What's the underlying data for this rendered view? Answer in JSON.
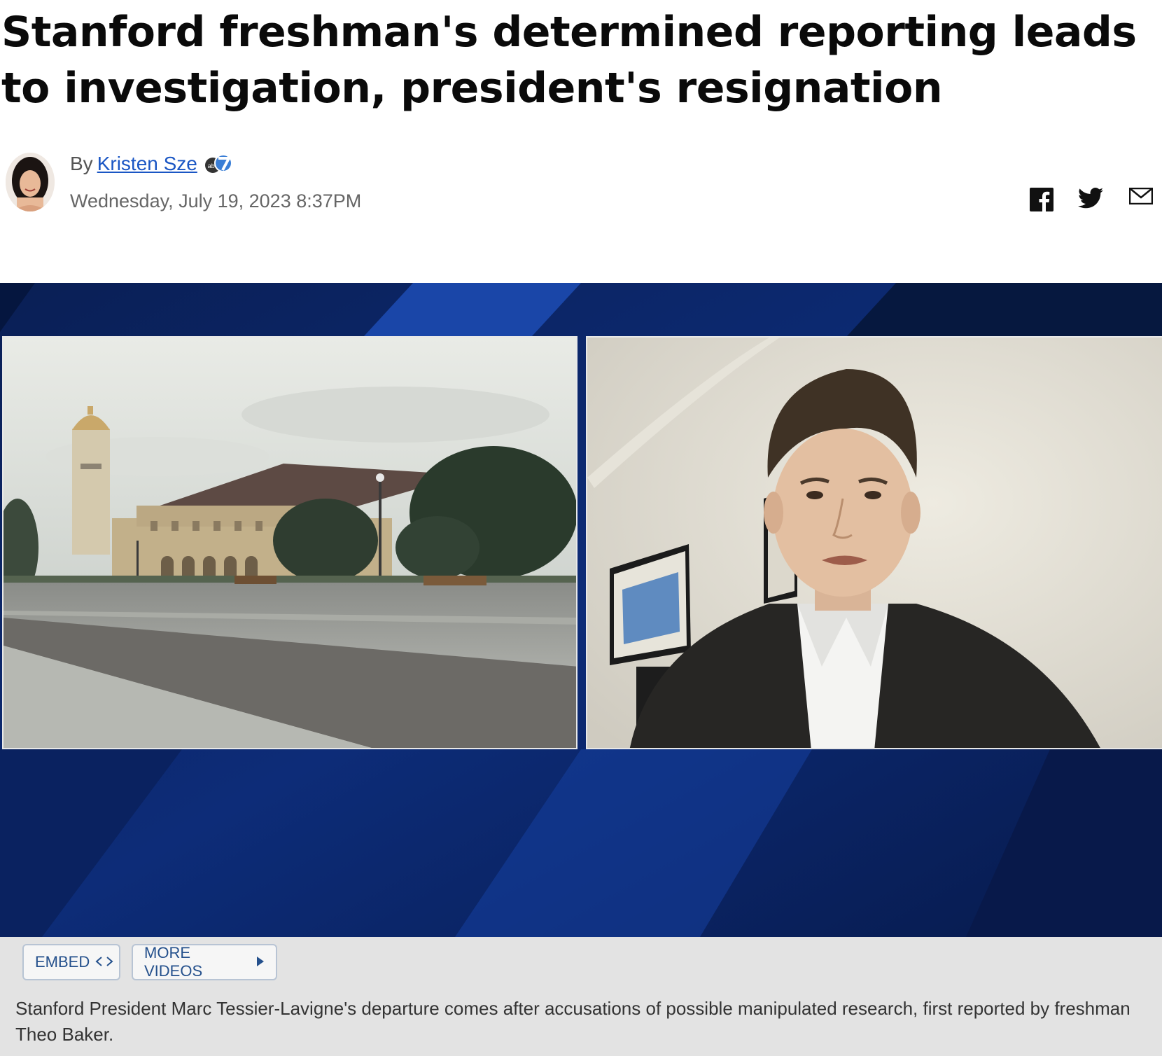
{
  "article": {
    "headline": "Stanford freshman's determined reporting leads to investigation, president's resignation",
    "byline_prefix": "By",
    "author": "Kristen Sze",
    "date": "Wednesday, July 19, 2023 8:37PM"
  },
  "share_icons": [
    "facebook-icon",
    "twitter-icon",
    "email-icon"
  ],
  "video": {
    "embed_label": "EMBED",
    "more_videos_label": "MORE VIDEOS",
    "caption": "Stanford President Marc Tessier-Lavigne's departure comes after accusations of possible manipulated research, first reported by freshman Theo Baker."
  },
  "colors": {
    "video_background": "#0b2566",
    "link": "#1a56c4",
    "button_text": "#24508c"
  }
}
